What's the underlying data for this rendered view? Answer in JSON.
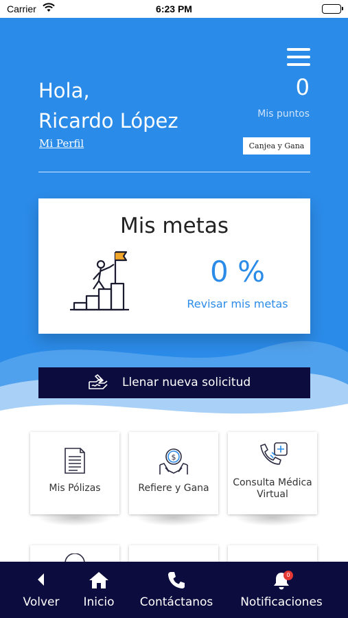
{
  "status_bar": {
    "carrier": "Carrier",
    "time": "6:23 PM"
  },
  "header": {
    "greeting": "Hola,",
    "user_name": "Ricardo López",
    "profile_link": "Mi Perfil",
    "points_value": "0",
    "points_label": "Mis puntos",
    "redeem_button": "Canjea y Gana"
  },
  "goals_card": {
    "title": "Mis metas",
    "percent": "0 %",
    "link": "Revisar mis metas"
  },
  "apply_button": {
    "label": "Llenar nueva solicitud"
  },
  "tiles": [
    {
      "label": "Mis Pólizas",
      "icon": "document-icon"
    },
    {
      "label": "Refiere y Gana",
      "icon": "hands-coin-icon"
    },
    {
      "label": "Consulta Médica Virtual",
      "icon": "phone-medical-icon"
    }
  ],
  "bottom_nav": [
    {
      "label": "Volver",
      "icon": "back-arrow-icon"
    },
    {
      "label": "Inicio",
      "icon": "home-icon"
    },
    {
      "label": "Contáctanos",
      "icon": "phone-icon"
    },
    {
      "label": "Notificaciones",
      "icon": "bell-icon",
      "badge": "0"
    }
  ],
  "colors": {
    "primary_blue": "#2b8be8",
    "navy": "#0c0c3e",
    "badge_red": "#e53935"
  }
}
